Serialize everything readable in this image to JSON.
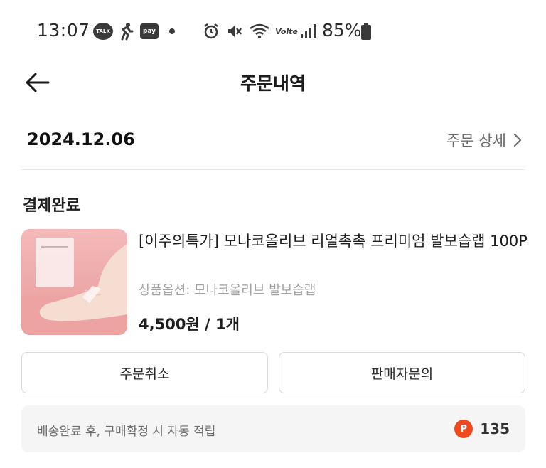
{
  "status_bar": {
    "time": "13:07",
    "talk_badge": "TALK",
    "pay_badge": "pay",
    "volte": "Volte",
    "battery": "85%"
  },
  "header": {
    "title": "주문내역"
  },
  "order": {
    "date": "2024.12.06",
    "detail_link": "주문 상세",
    "status": "결제완료"
  },
  "product": {
    "name": "[이주의특가] 모나코올리브 리얼촉촉 프리미엄 발보습랩 100P",
    "option": "상품옵션: 모나코올리브 발보습랩",
    "price": "4,500원 / 1개"
  },
  "actions": {
    "cancel_label": "주문취소",
    "inquiry_label": "판매자문의"
  },
  "points": {
    "message": "배송완료 후, 구매확정 시 자동 적립",
    "icon_letter": "P",
    "value": "135"
  },
  "colors": {
    "point_badge": "#ee4a1e",
    "points_bar_bg": "#f5f5f5",
    "button_border": "#d9d9d9"
  },
  "icons": [
    "back-arrow-icon",
    "chevron-right-icon",
    "point-icon"
  ]
}
